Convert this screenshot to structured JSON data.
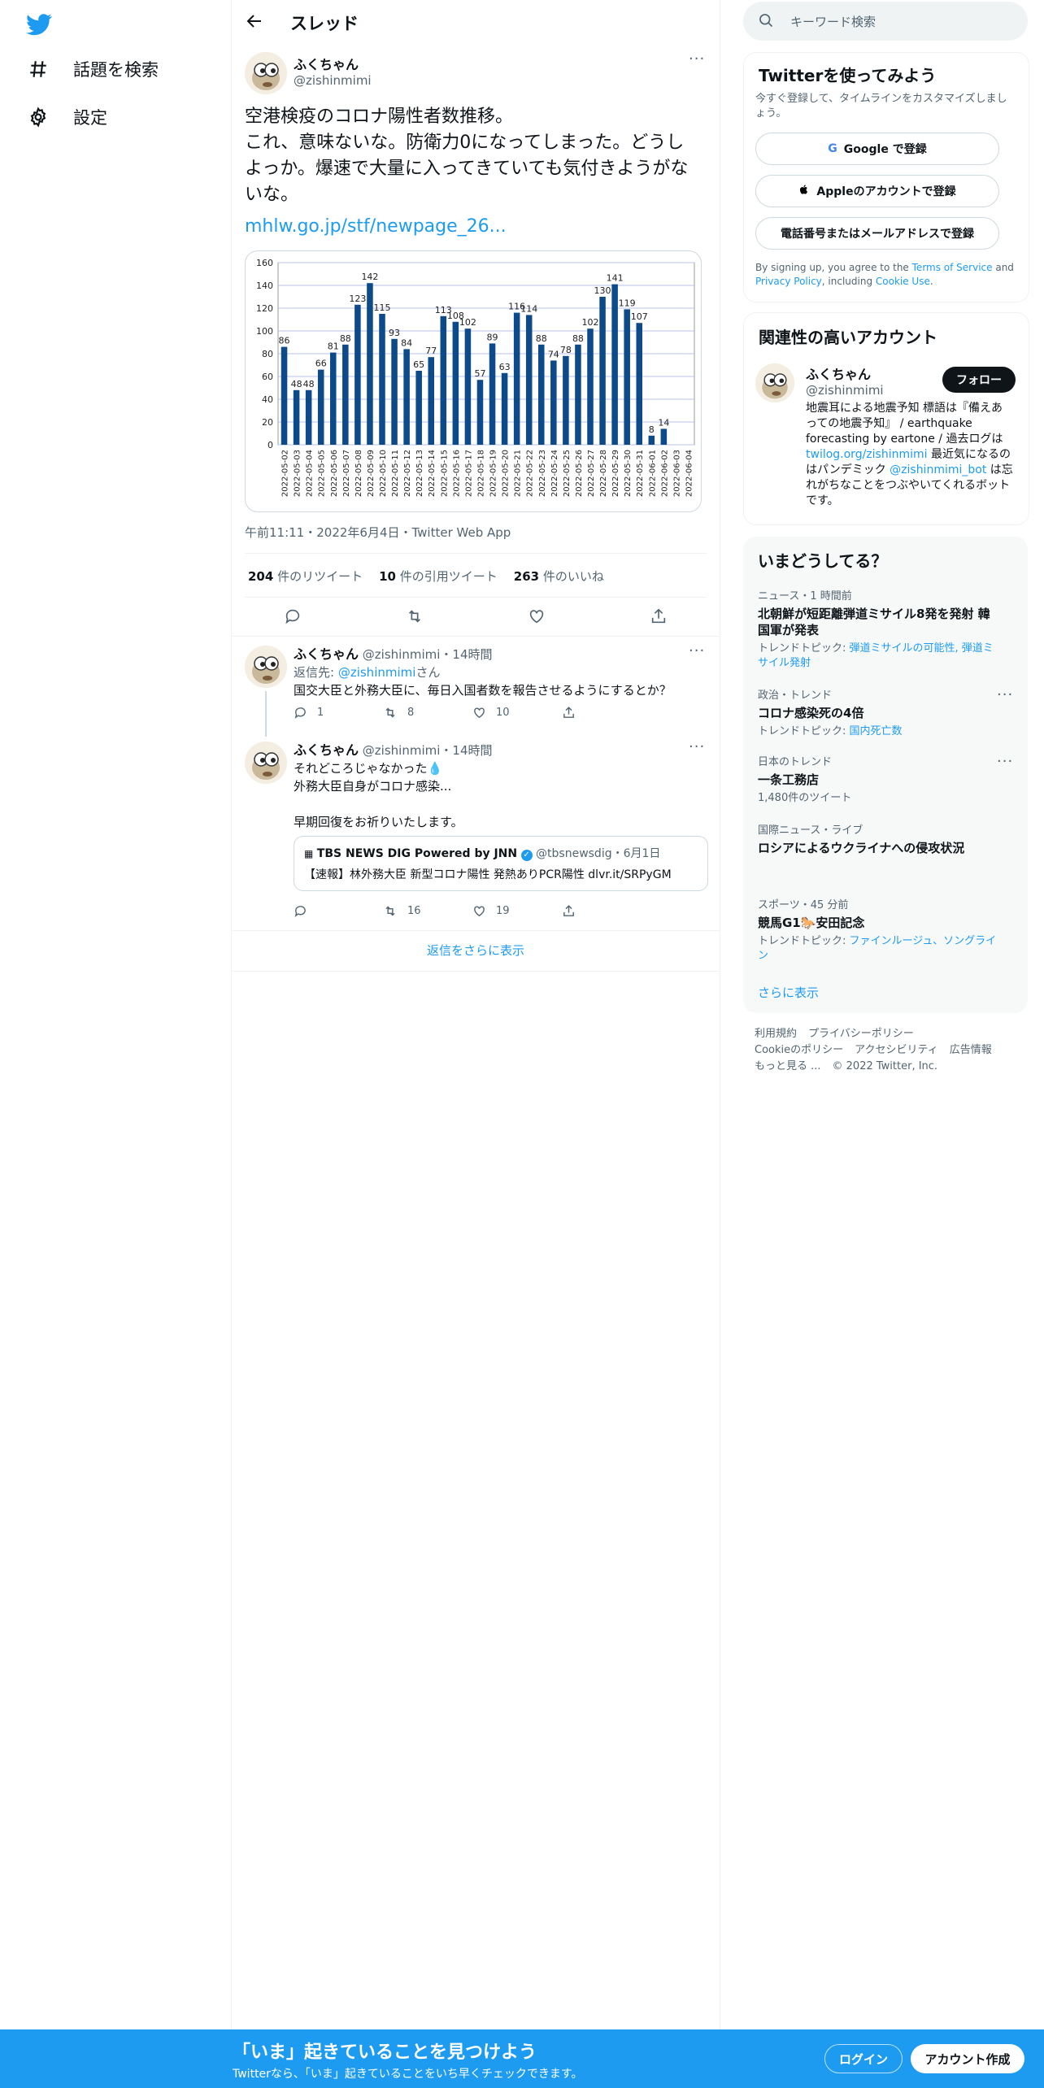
{
  "nav": {
    "explore_label": "話題を検索",
    "settings_label": "設定"
  },
  "header": {
    "title": "スレッド"
  },
  "tweet": {
    "name": "ふくちゃん",
    "handle": "@zishinmimi",
    "text": "空港検疫のコロナ陽性者数推移。\nこれ、意味ないな。防衛力0になってしまった。どうしよっか。爆速で大量に入ってきていても気付きようがないな。",
    "link": "mhlw.go.jp/stf/newpage_26...",
    "meta": "午前11:11・2022年6月4日・Twitter Web App",
    "retweets_count": "204",
    "retweets_label": "件のリツイート",
    "quotes_count": "10",
    "quotes_label": "件の引用ツイート",
    "likes_count": "263",
    "likes_label": "件のいいね"
  },
  "chart_data": {
    "type": "bar",
    "categories": [
      "2022-05-02",
      "2022-05-03",
      "2022-05-04",
      "2022-05-05",
      "2022-05-06",
      "2022-05-07",
      "2022-05-08",
      "2022-05-09",
      "2022-05-10",
      "2022-05-11",
      "2022-05-12",
      "2022-05-13",
      "2022-05-14",
      "2022-05-15",
      "2022-05-16",
      "2022-05-17",
      "2022-05-18",
      "2022-05-19",
      "2022-05-20",
      "2022-05-21",
      "2022-05-22",
      "2022-05-23",
      "2022-05-24",
      "2022-05-25",
      "2022-05-26",
      "2022-05-27",
      "2022-05-28",
      "2022-05-29",
      "2022-05-30",
      "2022-05-31",
      "2022-06-01",
      "2022-06-02",
      "2022-06-03",
      "2022-06-04"
    ],
    "values": [
      86,
      48,
      48,
      66,
      81,
      88,
      123,
      142,
      115,
      93,
      84,
      65,
      77,
      113,
      108,
      102,
      57,
      89,
      63,
      116,
      114,
      88,
      74,
      78,
      88,
      102,
      130,
      141,
      119,
      107,
      8,
      14
    ],
    "ylim": [
      0,
      160
    ],
    "yticks": [
      0,
      20,
      40,
      60,
      80,
      100,
      120,
      140,
      160
    ],
    "grid": true,
    "bar_color": "#0d4a8a"
  },
  "replies": [
    {
      "name": "ふくちゃん",
      "handle": "@zishinmimi",
      "time": "・14時間",
      "reply_to_prefix": "返信先: ",
      "reply_to_handle": "@zishinmimi",
      "reply_to_suffix": "さん",
      "text": "国交大臣と外務大臣に、毎日入国者数を報告させるようにするとか？",
      "reply_count": "1",
      "retweet_count": "8",
      "like_count": "10"
    },
    {
      "name": "ふくちゃん",
      "handle": "@zishinmimi",
      "time": "・14時間",
      "text": "それどころじゃなかった💧\n外務大臣自身がコロナ感染...\n\n早期回復をお祈りいたします。",
      "quote_source": "TBS NEWS DIG Powered by JNN",
      "quote_handle": "@tbsnewsdig",
      "quote_date": "・6月1日",
      "quote_text": "【速報】林外務大臣 新型コロナ陽性 発熱ありPCR陽性 dlvr.it/SRPyGM",
      "reply_count": "",
      "retweet_count": "16",
      "like_count": "19"
    }
  ],
  "show_more_replies": "返信をさらに表示",
  "search": {
    "placeholder": "キーワード検索"
  },
  "signup_panel": {
    "title": "Twitterを使ってみよう",
    "subtitle": "今すぐ登録して、タイムラインをカスタマイズしましょう。",
    "google_button": "Google で登録",
    "apple_button": "Appleのアカウントで登録",
    "phone_button": "電話番号またはメールアドレスで登録",
    "legal_1": "By signing up, you agree to the ",
    "terms_link": "Terms of Service",
    "legal_2": " and ",
    "privacy_link": "Privacy Policy",
    "legal_3": ", including ",
    "cookie_link": "Cookie Use",
    "legal_4": "."
  },
  "related_panel": {
    "title": "関連性の高いアカウント",
    "name": "ふくちゃん",
    "handle": "@zishinmimi",
    "follow_button": "フォロー",
    "bio_1": "地震耳による地震予知 標語は『備えあっての地震予知』 / earthquake forecasting by eartone / 過去ログは",
    "bio_link_1": "twilog.org/zishinmimi",
    "bio_2": " 最近気になるのはパンデミック ",
    "bio_link_2": "@zishinmimi_bot",
    "bio_3": " は忘れがちなことをつぶやいてくれるボットです。"
  },
  "trends_panel": {
    "title": "いまどうしてる？",
    "items": [
      {
        "context": "ニュース・1 時間前",
        "title": "北朝鮮が短距離弾道ミサイル8発を発射 韓国軍が発表",
        "sub_prefix": "トレンドトピック: ",
        "sub_links": "弾道ミサイルの可能性, 弾道ミサイル発射"
      },
      {
        "context": "政治・トレンド",
        "title": "コロナ感染死の4倍",
        "sub_prefix": "トレンドトピック: ",
        "sub_links": "国内死亡数"
      },
      {
        "context": "日本のトレンド",
        "title": "一条工務店",
        "sub_prefix": "1,480件のツイート",
        "sub_links": ""
      },
      {
        "context": "国際ニュース・ライブ",
        "title": "ロシアによるウクライナへの侵攻状況",
        "sub_prefix": "",
        "sub_links": ""
      },
      {
        "context": "スポーツ・45 分前",
        "title": "競馬G1🐎安田記念",
        "sub_prefix": "トレンドトピック: ",
        "sub_links": "ファインルージュ、ソングライン"
      }
    ],
    "show_more": "さらに表示"
  },
  "footer": {
    "terms": "利用規約",
    "privacy": "プライバシーポリシー",
    "cookie": "Cookieのポリシー",
    "accessibility": "アクセシビリティ",
    "ads": "広告情報",
    "more": "もっと見る ...",
    "copyright": "© 2022 Twitter, Inc."
  },
  "bottom_bar": {
    "headline": "「いま」起きていることを見つけよう",
    "sub": "Twitterなら、「いま」起きていることをいち早くチェックできます。",
    "login": "ログイン",
    "signup": "アカウント作成"
  }
}
